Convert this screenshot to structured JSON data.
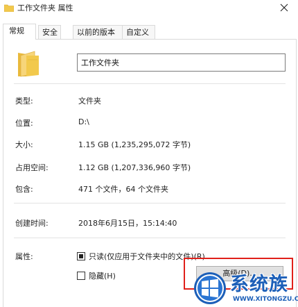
{
  "window": {
    "title": "工作文件夹 属性",
    "icons": {
      "title_icon": "folder-icon",
      "close": "close-icon"
    }
  },
  "tabs": [
    {
      "label": "常规",
      "active": true
    },
    {
      "label": "安全",
      "active": false
    },
    {
      "label": "以前的版本",
      "active": false
    },
    {
      "label": "自定义",
      "active": false
    }
  ],
  "general": {
    "folder_icon": "folder-icon",
    "name_value": "工作文件夹",
    "rows": {
      "type": {
        "label": "类型:",
        "value": "文件夹"
      },
      "location": {
        "label": "位置:",
        "value": "D:\\"
      },
      "size": {
        "label": "大小:",
        "value": "1.15 GB (1,235,295,072 字节)"
      },
      "disk_size": {
        "label": "占用空间:",
        "value": "1.12 GB (1,207,336,960 字节)"
      },
      "contains": {
        "label": "包含:",
        "value": "471 个文件，64 个文件夹"
      },
      "created": {
        "label": "创建时间:",
        "value": "2018年6月15日，15:14:40"
      }
    },
    "attributes": {
      "label": "属性:",
      "readonly": {
        "label": "只读(仅应用于文件夹中的文件)(R)",
        "state": "indeterminate"
      },
      "hidden": {
        "label": "隐藏(H)",
        "state": "unchecked"
      },
      "advanced_button": "高级(D)..."
    }
  },
  "watermark": {
    "name": "系统族",
    "url": "WWW.XITONGZU.COM",
    "logo_icon": "windows-logo-icon"
  },
  "colors": {
    "highlight_border": "#e0201a",
    "watermark_blue": "#1c5fb8",
    "folder_yellow": "#f2c94c"
  }
}
